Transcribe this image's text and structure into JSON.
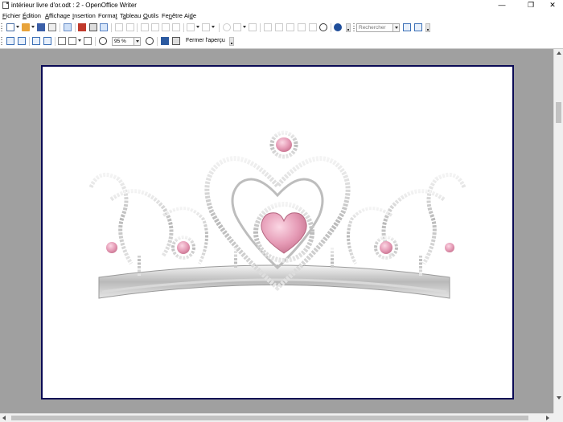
{
  "window": {
    "title": "intérieur livre d'or.odt : 2 - OpenOffice Writer",
    "minimize_glyph": "—",
    "restore_glyph": "❐",
    "close_glyph": "✕"
  },
  "menu": {
    "items": [
      {
        "mnemonic": "F",
        "rest": "ichier"
      },
      {
        "mnemonic": "É",
        "rest": "dition"
      },
      {
        "mnemonic": "A",
        "rest": "ffichage"
      },
      {
        "mnemonic": "I",
        "rest": "nsertion"
      },
      {
        "pre": "Forma",
        "mnemonic": "t",
        "rest": ""
      },
      {
        "pre": "T",
        "mnemonic": "a",
        "rest": "bleau"
      },
      {
        "mnemonic": "O",
        "rest": "utils"
      },
      {
        "pre": "Fe",
        "mnemonic": "n",
        "rest": "être"
      },
      {
        "pre": "Ai",
        "mnemonic": "d",
        "rest": "e"
      }
    ]
  },
  "toolbar1": {
    "search_placeholder": "Rechercher",
    "accent_help": "#1f4e9a",
    "accent_pdf": "#c0392b"
  },
  "toolbar2": {
    "zoom_value": "95 %",
    "close_preview_label": "Fermer l'aperçu"
  },
  "document": {
    "image_subject": "tiara-with-pink-jewels",
    "page_border_color": "#0a0a55",
    "workspace_color": "#a0a0a0"
  }
}
